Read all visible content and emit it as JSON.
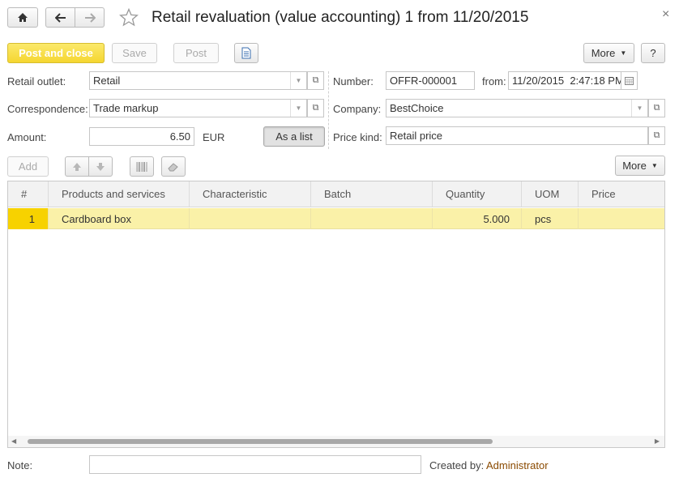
{
  "window": {
    "title": "Retail revaluation (value accounting) 1 from 11/20/2015",
    "close_glyph": "×"
  },
  "nav": {
    "home_icon": "home-icon",
    "back_icon": "arrow-left-icon",
    "forward_icon": "arrow-right-icon",
    "favorite_icon": "star-icon"
  },
  "toolbar": {
    "post_and_close": "Post and close",
    "save": "Save",
    "post": "Post",
    "document_icon": "document-icon",
    "more": "More",
    "help": "?"
  },
  "form": {
    "retail_outlet_label": "Retail outlet:",
    "retail_outlet_value": "Retail",
    "correspondence_label": "Correspondence:",
    "correspondence_value": "Trade markup",
    "amount_label": "Amount:",
    "amount_value": "6.50",
    "currency": "EUR",
    "as_a_list": "As a list",
    "number_label": "Number:",
    "number_value": "OFFR-000001",
    "from_label": "from:",
    "from_value": "11/20/2015  2:47:18 PM",
    "company_label": "Company:",
    "company_value": "BestChoice",
    "price_kind_label": "Price kind:",
    "price_kind_value": "Retail price"
  },
  "table_toolbar": {
    "add": "Add",
    "move_up_icon": "arrow-up-icon",
    "move_down_icon": "arrow-down-icon",
    "barcode_icon": "barcode-icon",
    "eraser_icon": "eraser-icon",
    "more": "More"
  },
  "table": {
    "columns": [
      "#",
      "Products and services",
      "Characteristic",
      "Batch",
      "Quantity",
      "UOM",
      "Price"
    ],
    "rows": [
      {
        "n": "1",
        "product": "Cardboard box",
        "characteristic": "",
        "batch": "",
        "quantity": "5.000",
        "uom": "pcs",
        "price": ""
      }
    ]
  },
  "footer": {
    "note_label": "Note:",
    "note_value": "",
    "created_by_label": "Created by:",
    "created_by_value": "Administrator"
  },
  "colors": {
    "primary_button": "#f5d630",
    "selected_row": "#faf1a8",
    "row_number_cell": "#f7d200",
    "author_link": "#8a4a00"
  }
}
